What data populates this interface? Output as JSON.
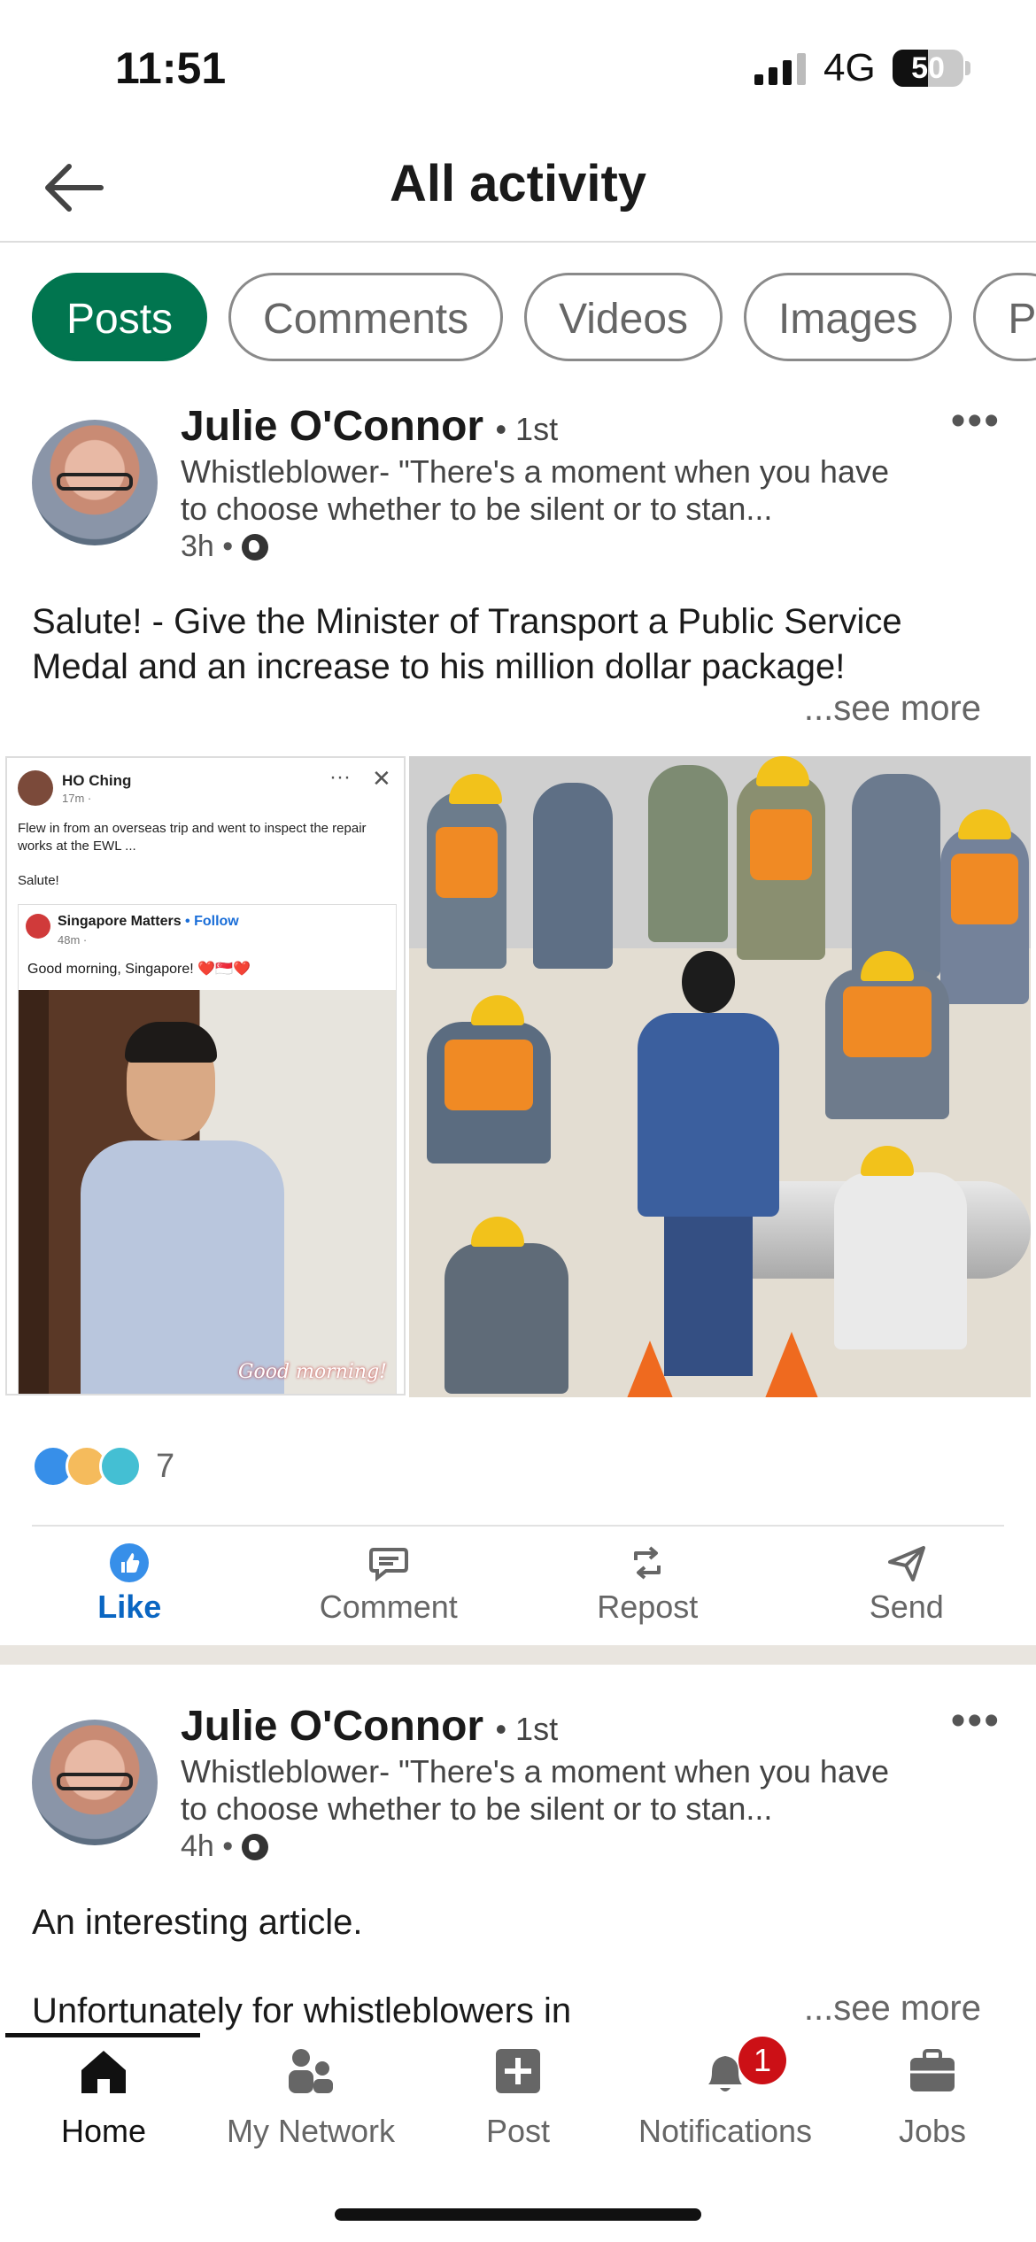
{
  "status_bar": {
    "time": "11:51",
    "network": "4G",
    "battery": "50",
    "battery_level": 0.5
  },
  "header": {
    "title": "All activity",
    "back_icon": "arrow-left-icon"
  },
  "filters": [
    "Posts",
    "Comments",
    "Videos",
    "Images",
    "P"
  ],
  "posts": [
    {
      "author": "Julie O'Connor",
      "degree": "• 1st",
      "headline": "Whistleblower- \"There's a moment when you have to choose whether to be silent or to stan...",
      "time": "3h •",
      "text": "Salute! - Give the Minister of Transport a Public Service Medal and an increase to his million dollar package!",
      "see_more": "...see more",
      "shared_image": {
        "fb_name": "HO Ching",
        "fb_meta": "17m · ",
        "fb_text": "Flew in from an overseas trip and went to inspect the repair works at the EWL ...",
        "fb_salute": "Salute!",
        "inner_name": "Singapore Matters",
        "inner_follow": "• Follow",
        "inner_meta": "48m · ",
        "inner_text": "Good morning, Singapore! ❤️🇸🇬❤️",
        "photo_caption": "Good morning!"
      },
      "reaction_count": "7"
    },
    {
      "author": "Julie O'Connor",
      "degree": "• 1st",
      "headline": "Whistleblower- \"There's a moment when you have to choose whether to be silent or to stan...",
      "time": "4h •",
      "text_line1": "An interesting article.",
      "text_line2": "Unfortunately for whistleblowers in",
      "see_more": "...see more"
    }
  ],
  "actions": [
    "Like",
    "Comment",
    "Repost",
    "Send"
  ],
  "tabs": [
    "Home",
    "My Network",
    "Post",
    "Notifications",
    "Jobs"
  ],
  "notification_badge": "1",
  "colors": {
    "accent": "#01754f",
    "link": "#0a66c2",
    "badge": "#cc1016"
  }
}
